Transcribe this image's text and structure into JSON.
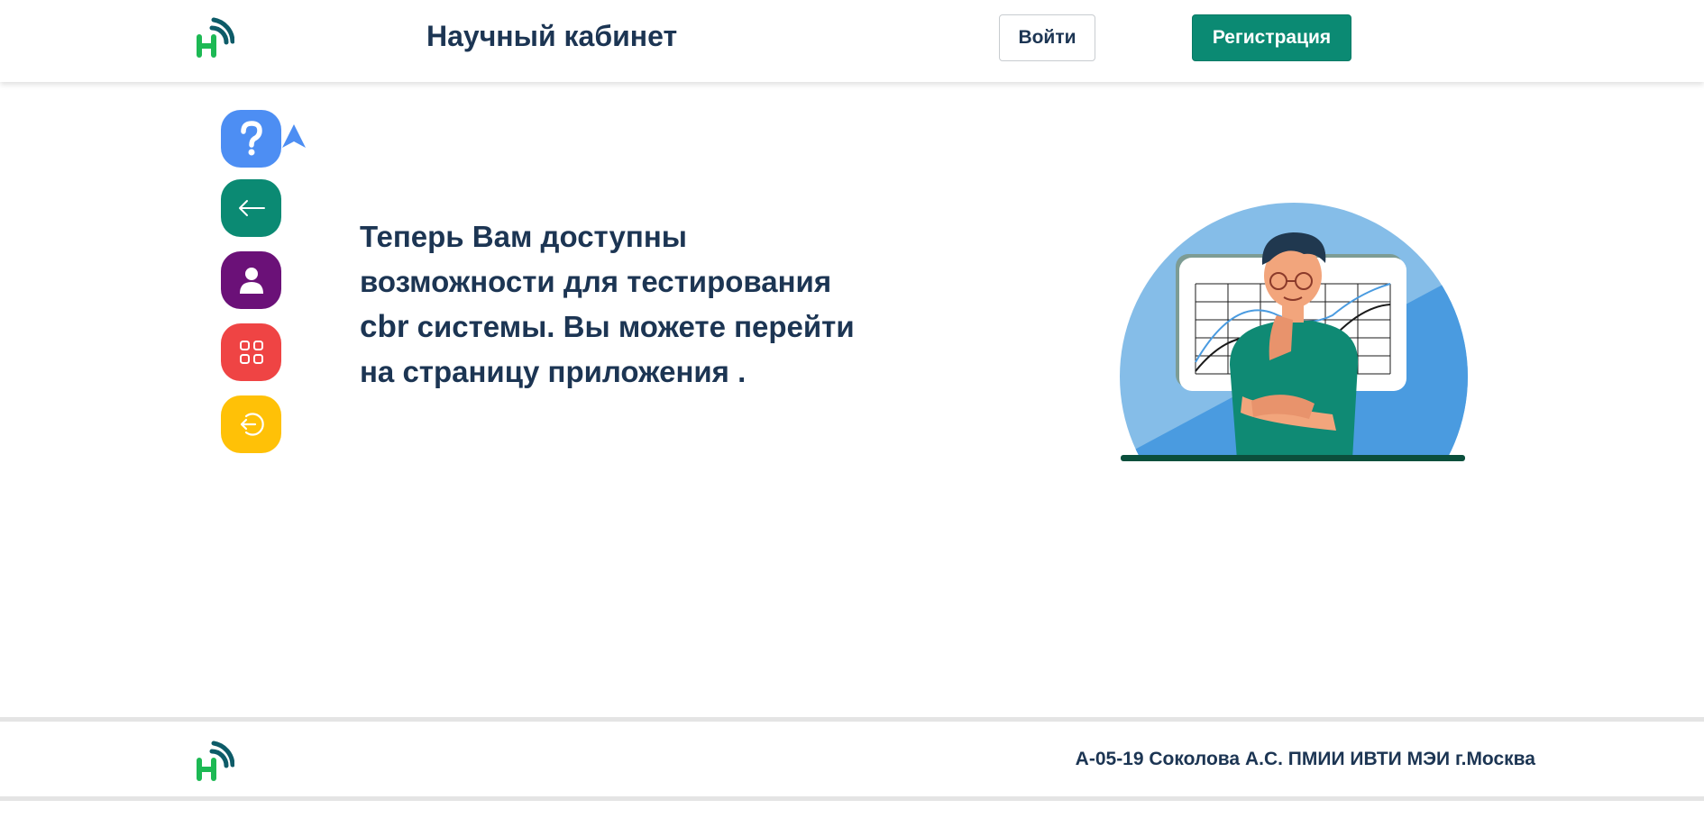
{
  "header": {
    "title": "Научный кабинет",
    "login_label": "Войти",
    "register_label": "Регистрация"
  },
  "sidebar": {
    "items": [
      {
        "icon": "question-icon",
        "color": "#4d8ef3"
      },
      {
        "icon": "arrow-left-icon",
        "color": "#0b8a73"
      },
      {
        "icon": "user-icon",
        "color": "#6b1178"
      },
      {
        "icon": "grid-icon",
        "color": "#ef4444"
      },
      {
        "icon": "logout-icon",
        "color": "#ffc107"
      }
    ]
  },
  "main": {
    "text_before": "Теперь Вам доступны возможности для тестирования ",
    "text_strong": "cbr",
    "text_after": " системы. Вы можете перейти на страницу приложения ."
  },
  "footer": {
    "text": "А-05-19 Соколова А.С. ПМИИ ИВТИ МЭИ г.Москва"
  },
  "colors": {
    "primary": "#0b8a73",
    "text": "#1c3553",
    "accent_blue": "#4d8ef3"
  }
}
